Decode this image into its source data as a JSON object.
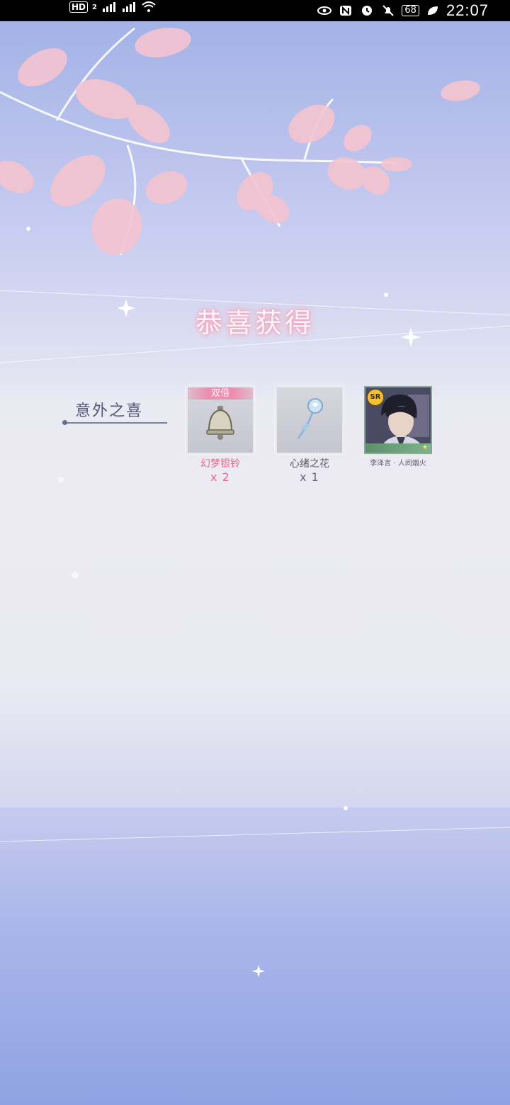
{
  "status_bar": {
    "hd_label": "HD",
    "sim_number": "2",
    "battery": "68",
    "time": "22:07",
    "icons": [
      "signal-icon",
      "signal-icon",
      "wifi-icon",
      "eye-icon",
      "nfc-icon",
      "alarm-icon",
      "mute-icon",
      "leaf-icon"
    ]
  },
  "title": "恭喜获得",
  "category": {
    "label": "意外之喜"
  },
  "rewards": [
    {
      "badge": "双倍",
      "name": "幻梦银铃",
      "quantity": "x 2",
      "icon": "bell-icon",
      "highlight": true
    },
    {
      "name": "心绪之花",
      "quantity": "x 1",
      "icon": "rose-icon",
      "highlight": false
    },
    {
      "rarity": "SR",
      "name": "李泽言 · 人间烟火",
      "icon": "character-card",
      "highlight": false
    }
  ],
  "colors": {
    "title_glow": "#f0a0bc",
    "highlight_text": "#e86c8a",
    "sky_top": "#9fb0e6",
    "sky_bottom": "#8fa2e2"
  }
}
